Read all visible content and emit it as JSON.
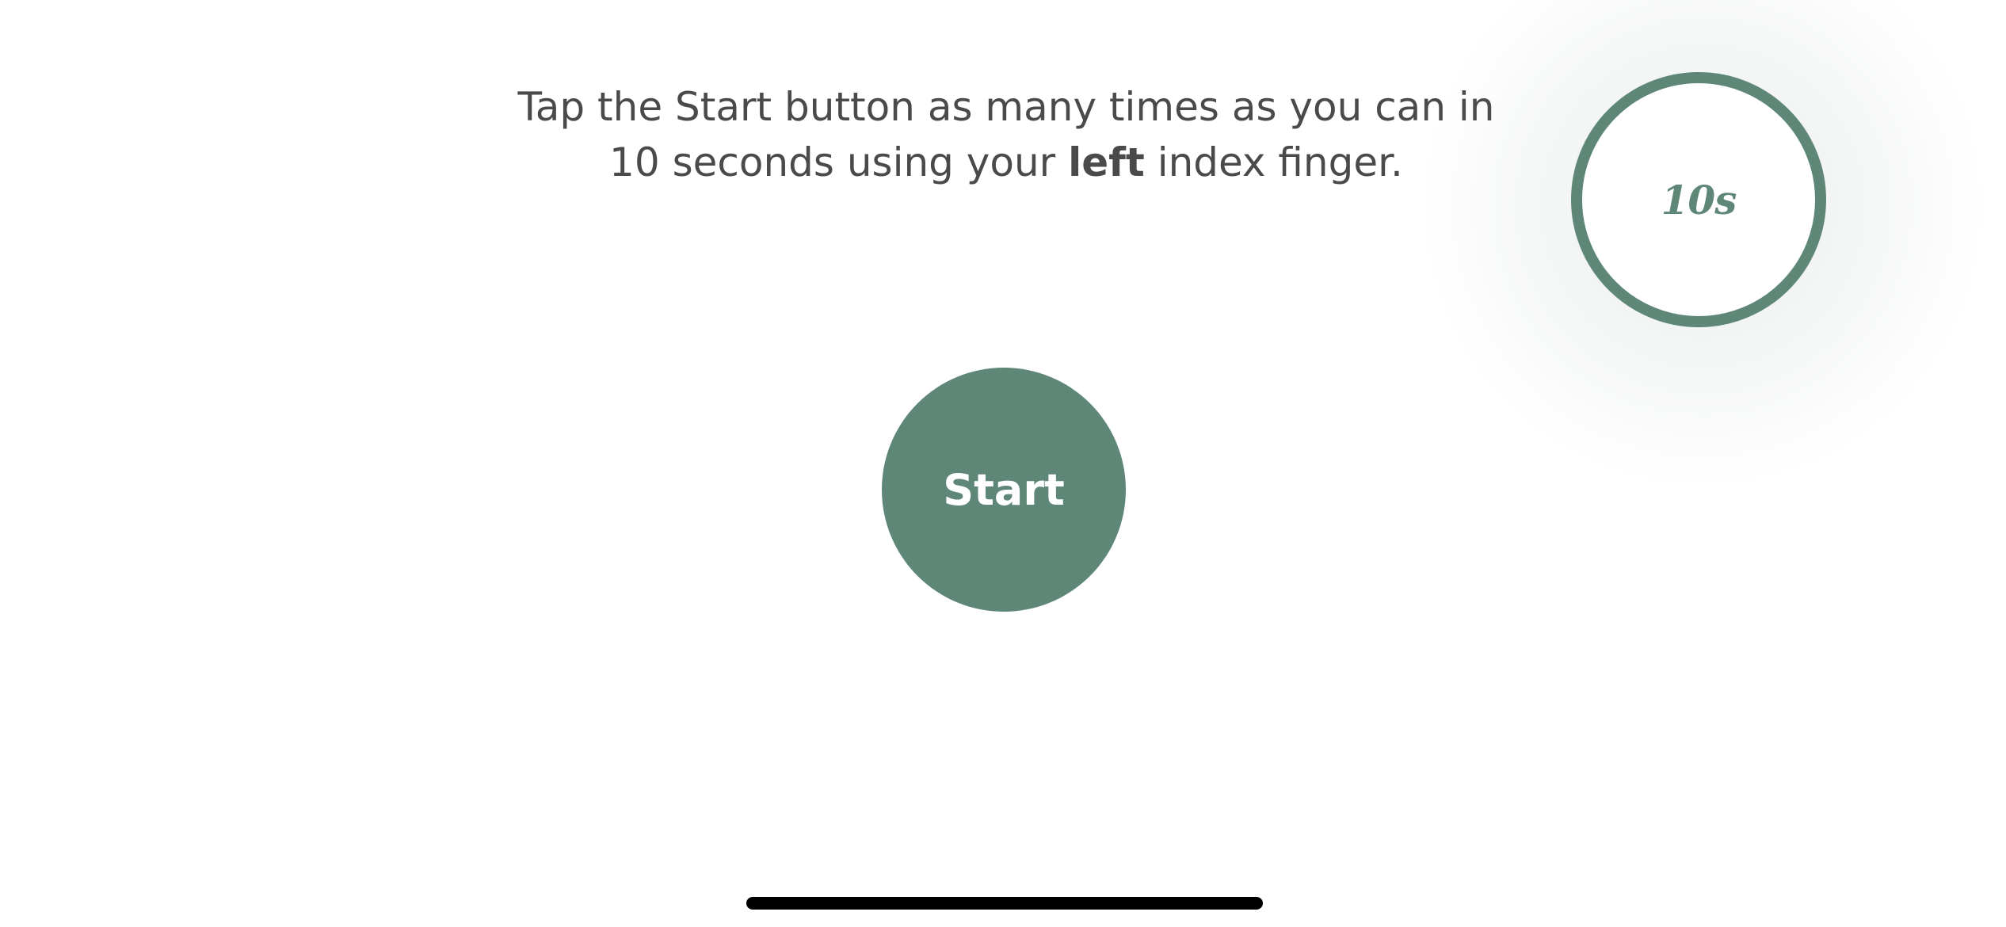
{
  "instructions": {
    "line1": "Tap the Start button as many times as you can in",
    "line2_before": "10 seconds using your ",
    "line2_bold": "left",
    "line2_after": " index finger."
  },
  "timer": {
    "label": "10s"
  },
  "start_button": {
    "label": "Start"
  },
  "colors": {
    "accent": "#5f8777",
    "text": "#4a4a4a",
    "background": "#ffffff",
    "home_indicator": "#000000"
  }
}
